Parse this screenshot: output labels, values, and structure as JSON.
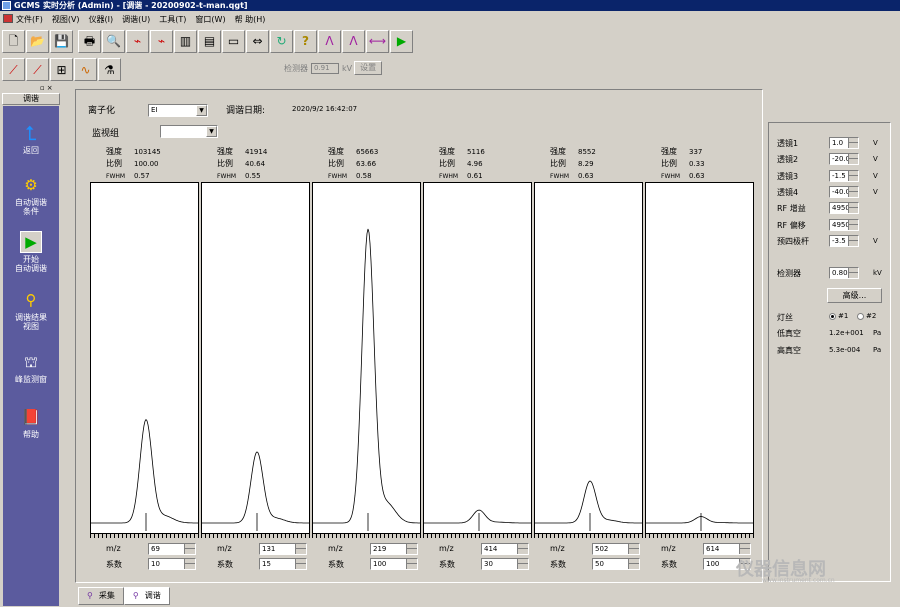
{
  "window": {
    "title": "GCMS 实时分析 (Admin) - [调谐 - 20200902-t-man.qgt]"
  },
  "menu": [
    "文件(F)",
    "视图(V)",
    "仪器(I)",
    "调谐(U)",
    "工具(T)",
    "窗口(W)",
    "帮 助(H)"
  ],
  "toolbar_icons": [
    "new-file-icon",
    "open-folder-icon",
    "save-icon",
    "print-icon",
    "print-preview-icon",
    "chart-settings-icon",
    "chart-compare-icon",
    "layout-left-icon",
    "layout-bottom-icon",
    "window-icon",
    "arrows-icon",
    "refresh-icon",
    "help-icon",
    "peak-3-icon",
    "peak-6-icon",
    "peak-scan-icon",
    "play-icon"
  ],
  "toolbar2_icons": [
    "line-edit-icon",
    "line-add-icon",
    "sample-icon",
    "spectrum-icon",
    "vial-icon"
  ],
  "detector_row": {
    "label": "检测器",
    "value": "0.91",
    "unit": "kV",
    "button": "设置"
  },
  "left_panel": {
    "title": "调谐",
    "items": [
      {
        "label": "返回",
        "icon": "back-arrow-icon"
      },
      {
        "label": "自动调谐\n条件",
        "icon": "auto-tune-condition-icon"
      },
      {
        "label": "开始\n自动调谐",
        "icon": "start-auto-tune-icon"
      },
      {
        "label": "调谐结果\n视图",
        "icon": "tune-result-view-icon"
      },
      {
        "label": "峰监测窗",
        "icon": "peak-monitor-icon"
      },
      {
        "label": "帮助",
        "icon": "help-book-icon"
      }
    ]
  },
  "main": {
    "ionization_label": "离子化",
    "ionization_value": "EI",
    "tune_date_label": "调谐日期:",
    "tune_date_value": "2020/9/2 16:42:07",
    "monitor_group_label": "监视组",
    "monitor_group_value": "",
    "stat_labels": {
      "intensity": "强度",
      "ratio": "比例",
      "fwhm": "FWHM"
    },
    "mz_label": "m/z",
    "factor_label": "系数"
  },
  "panels": [
    {
      "intensity": "103145",
      "ratio": "100.00",
      "fwhm": "0.57",
      "mz": "69",
      "factor": "10",
      "peak_level": 0.32
    },
    {
      "intensity": "41914",
      "ratio": "40.64",
      "fwhm": "0.55",
      "mz": "131",
      "factor": "15",
      "peak_level": 0.22
    },
    {
      "intensity": "65663",
      "ratio": "63.66",
      "fwhm": "0.58",
      "mz": "219",
      "factor": "100",
      "peak_level": 0.91
    },
    {
      "intensity": "5116",
      "ratio": "4.96",
      "fwhm": "0.61",
      "mz": "414",
      "factor": "30",
      "peak_level": 0.04
    },
    {
      "intensity": "8552",
      "ratio": "8.29",
      "fwhm": "0.63",
      "mz": "502",
      "factor": "50",
      "peak_level": 0.13
    },
    {
      "intensity": "337",
      "ratio": "0.33",
      "fwhm": "0.63",
      "mz": "614",
      "factor": "100",
      "peak_level": 0.02
    }
  ],
  "right_panel": {
    "rows": [
      {
        "label": "透镜1",
        "value": "1.0",
        "unit": "V"
      },
      {
        "label": "透镜2",
        "value": "-20.0",
        "unit": "V"
      },
      {
        "label": "透镜3",
        "value": "-1.5",
        "unit": "V"
      },
      {
        "label": "透镜4",
        "value": "-40.0",
        "unit": "V"
      },
      {
        "label": "RF 增益",
        "value": "4950",
        "unit": ""
      },
      {
        "label": "RF 偏移",
        "value": "4950",
        "unit": ""
      },
      {
        "label": "预四极杆",
        "value": "-3.5",
        "unit": "V"
      }
    ],
    "detector_label": "检测器",
    "detector_value": "0.80",
    "detector_unit": "kV",
    "advanced_button": "高级...",
    "filament_label": "灯丝",
    "filament_options": [
      "#1",
      "#2"
    ],
    "low_vacuum_label": "低真空",
    "low_vacuum_value": "1.2e+001",
    "low_vacuum_unit": "Pa",
    "high_vacuum_label": "高真空",
    "high_vacuum_value": "5.3e-004",
    "high_vacuum_unit": "Pa"
  },
  "tabs": [
    {
      "label": "采集",
      "active": false
    },
    {
      "label": "调谐",
      "active": true
    }
  ],
  "watermark": {
    "main": "仪器信息网",
    "sub": "www.instrument.com.cn"
  }
}
